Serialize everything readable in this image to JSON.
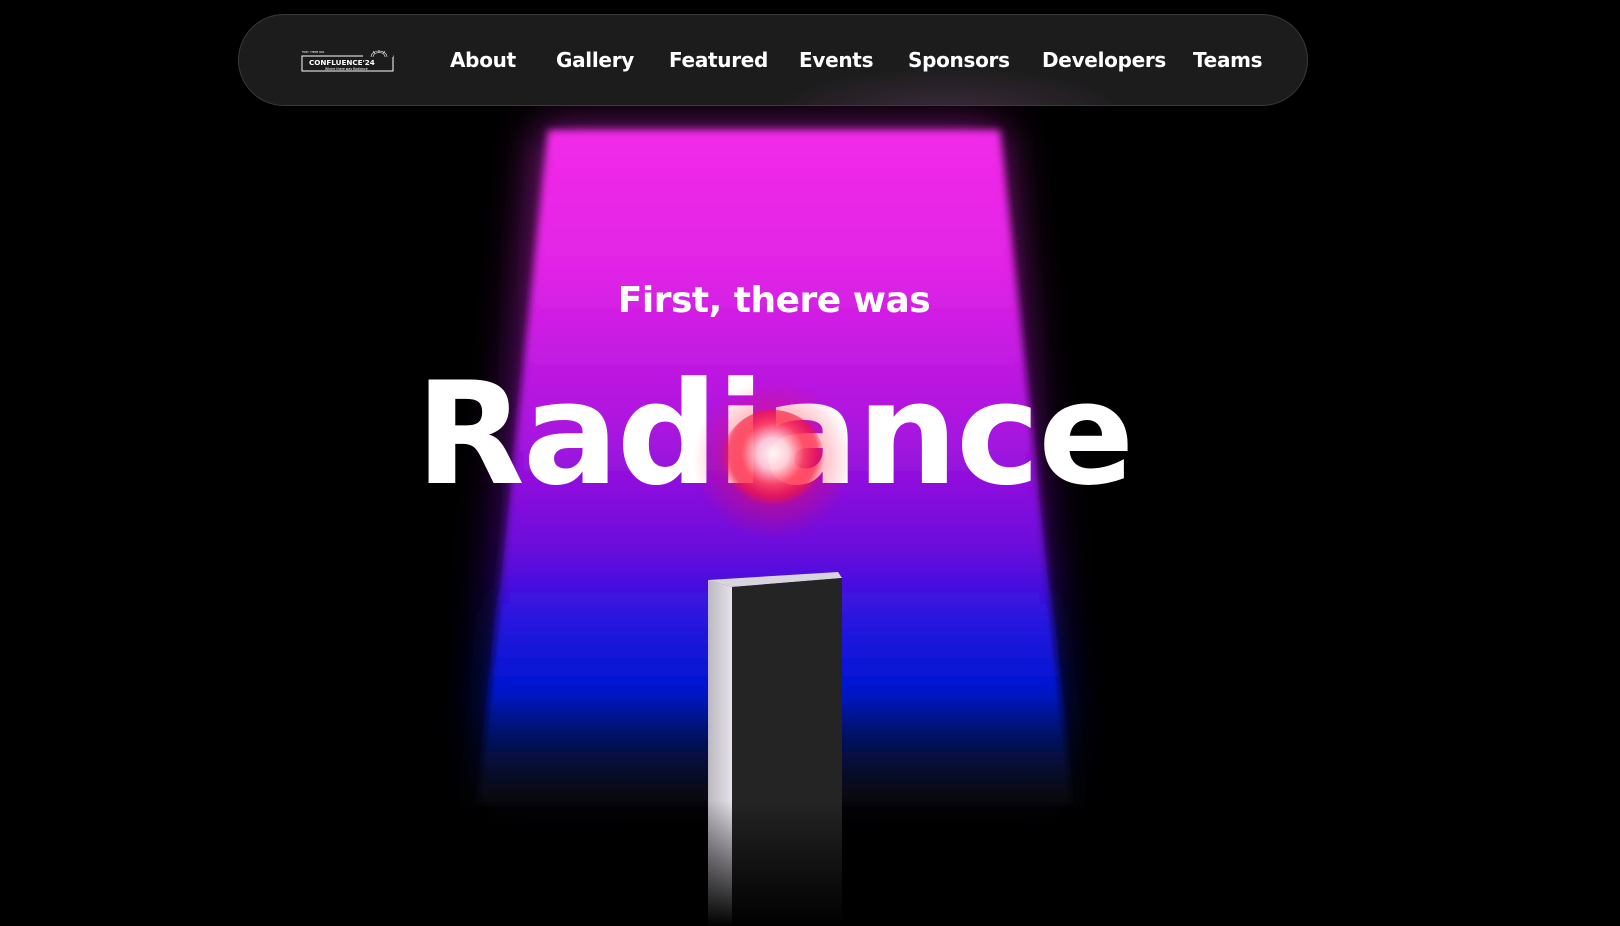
{
  "brand": {
    "logo_text": "CONFLUENCE'24",
    "logo_tagline": "Where there was Radiance",
    "logo_topline": "FIRST, THERE WAS"
  },
  "nav": {
    "items": [
      {
        "label": "About"
      },
      {
        "label": "Gallery"
      },
      {
        "label": "Featured"
      },
      {
        "label": "Events"
      },
      {
        "label": "Sponsors"
      },
      {
        "label": "Developers"
      },
      {
        "label": "Teams"
      }
    ]
  },
  "hero": {
    "pre_heading": "First, there was",
    "heading": "Radiance"
  },
  "colors": {
    "beam_top": "#f028e6",
    "beam_mid": "#8a10dc",
    "beam_low": "#0010d0",
    "orb": "#ff1030",
    "background": "#000000",
    "nav_bg": "#1c1c1c"
  }
}
